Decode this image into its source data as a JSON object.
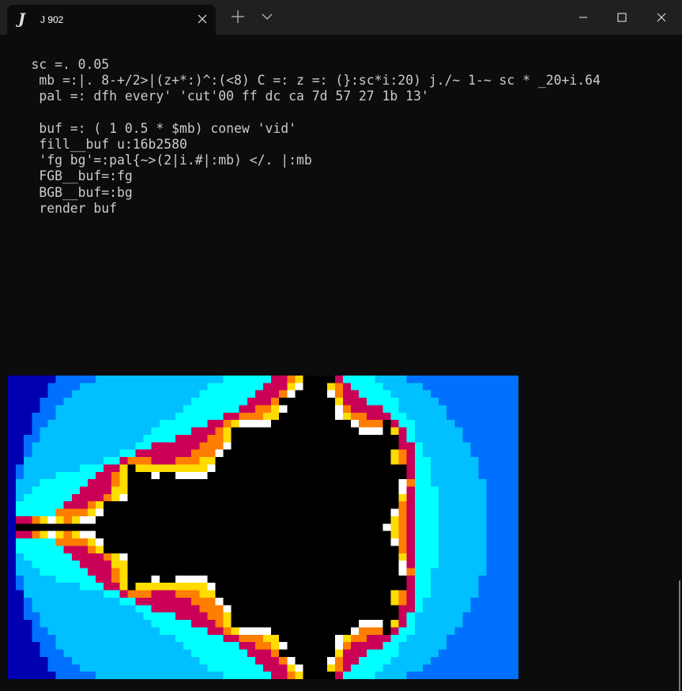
{
  "titlebar": {
    "tab_logo": "J",
    "tab_title": "J 902",
    "tab_close_icon": "close-icon",
    "new_tab_icon": "plus-icon",
    "dropdown_icon": "chevron-down-icon",
    "minimize_icon": "minimize-icon",
    "maximize_icon": "maximize-icon",
    "close_icon": "close-icon"
  },
  "console": {
    "lines": [
      "    sc =. 0.05",
      "     mb =:|. 8-+/2>|(z+*:)^:(<8) C =: z =: (}:sc*i:20) j./~ 1-~ sc * _20+i.64",
      "     pal =: dfh every' 'cut'00 ff dc ca 7d 57 27 1b 13'",
      "",
      "     buf =: ( 1 0.5 * $mb) conew 'vid'",
      "     fill__buf u:16b2580",
      "     'fg bg'=:pal{~>(2|i.#|:mb) </. |:mb",
      "     FGB__buf=:fg",
      "     BGB__buf=:bg",
      "     render buf"
    ]
  },
  "mandelbrot": {
    "scale": 0.05,
    "columns": 64,
    "rows": 41,
    "iterations": 8,
    "palette": [
      "#000000",
      "#ffffff",
      "#ffdc00",
      "#ff7d00",
      "#ca0057",
      "#00ffff",
      "#00c0ff",
      "#0070ff",
      "#0000b0"
    ]
  },
  "colors": {
    "background": "#0c0c0c",
    "titlebar": "#202020",
    "text": "#cccccc"
  }
}
